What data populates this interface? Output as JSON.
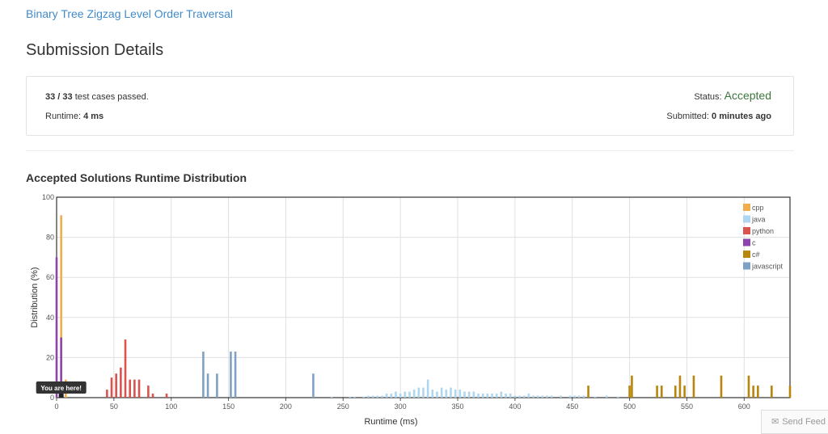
{
  "problem": {
    "title": "Binary Tree Zigzag Level Order Traversal"
  },
  "page": {
    "title": "Submission Details"
  },
  "submission": {
    "passed": "33 / 33",
    "passed_suffix": " test cases passed.",
    "runtime_label": "Runtime: ",
    "runtime_value": "4 ms",
    "status_label": "Status: ",
    "status_value": "Accepted",
    "submitted_label": "Submitted: ",
    "submitted_value": "0 minutes ago"
  },
  "distribution": {
    "title": "Accepted Solutions Runtime Distribution"
  },
  "marker": {
    "text": "You are here!"
  },
  "feedback": {
    "label": "Send Feed",
    "icon": "envelope-icon"
  },
  "chart_data": {
    "type": "bar",
    "xlabel": "Runtime (ms)",
    "ylabel": "Distribution (%)",
    "xlim": [
      0,
      640
    ],
    "ylim": [
      0,
      100
    ],
    "xticks": [
      0,
      50,
      100,
      150,
      200,
      250,
      300,
      350,
      400,
      450,
      500,
      550,
      600
    ],
    "yticks": [
      0,
      20,
      40,
      60,
      80,
      100
    ],
    "grid": true,
    "legend": "top-right",
    "marker_x": 4,
    "series": [
      {
        "name": "cpp",
        "color": "#f0ad4e",
        "points": [
          [
            4,
            91
          ],
          [
            8,
            9
          ]
        ]
      },
      {
        "name": "java",
        "color": "#aed6f1",
        "points": [
          [
            240,
            0.5
          ],
          [
            256,
            0.5
          ],
          [
            260,
            0.5
          ],
          [
            268,
            0.5
          ],
          [
            272,
            1
          ],
          [
            276,
            1
          ],
          [
            280,
            1
          ],
          [
            284,
            1
          ],
          [
            288,
            2
          ],
          [
            292,
            2
          ],
          [
            296,
            3
          ],
          [
            300,
            2
          ],
          [
            304,
            3
          ],
          [
            308,
            3
          ],
          [
            312,
            4
          ],
          [
            316,
            5
          ],
          [
            320,
            5
          ],
          [
            324,
            9
          ],
          [
            328,
            4
          ],
          [
            332,
            3
          ],
          [
            336,
            5
          ],
          [
            340,
            4
          ],
          [
            344,
            5
          ],
          [
            348,
            4
          ],
          [
            352,
            4
          ],
          [
            356,
            3
          ],
          [
            360,
            3
          ],
          [
            364,
            3
          ],
          [
            368,
            2
          ],
          [
            372,
            2
          ],
          [
            376,
            2
          ],
          [
            380,
            2
          ],
          [
            384,
            2
          ],
          [
            388,
            3
          ],
          [
            392,
            2
          ],
          [
            396,
            2
          ],
          [
            400,
            1
          ],
          [
            404,
            1
          ],
          [
            408,
            1
          ],
          [
            412,
            2
          ],
          [
            416,
            1
          ],
          [
            420,
            1
          ],
          [
            424,
            1
          ],
          [
            428,
            1
          ],
          [
            432,
            1
          ],
          [
            440,
            1
          ],
          [
            448,
            1
          ],
          [
            452,
            1
          ],
          [
            456,
            1
          ],
          [
            460,
            1
          ],
          [
            470,
            0.5
          ],
          [
            480,
            1
          ],
          [
            490,
            0.5
          ]
        ]
      },
      {
        "name": "python",
        "color": "#d9534f",
        "points": [
          [
            44,
            4
          ],
          [
            48,
            10
          ],
          [
            52,
            12
          ],
          [
            56,
            15
          ],
          [
            60,
            29
          ],
          [
            64,
            9
          ],
          [
            68,
            9
          ],
          [
            72,
            9
          ],
          [
            80,
            6
          ],
          [
            84,
            2
          ],
          [
            96,
            2
          ]
        ]
      },
      {
        "name": "c",
        "color": "#8e44ad",
        "points": [
          [
            0,
            70
          ],
          [
            4,
            30
          ]
        ]
      },
      {
        "name": "c#",
        "color": "#b8860b",
        "points": [
          [
            464,
            6
          ],
          [
            500,
            6
          ],
          [
            502,
            11
          ],
          [
            524,
            6
          ],
          [
            528,
            6
          ],
          [
            540,
            6
          ],
          [
            544,
            11
          ],
          [
            548,
            6
          ],
          [
            556,
            11
          ],
          [
            580,
            11
          ],
          [
            604,
            11
          ],
          [
            608,
            6
          ],
          [
            612,
            6
          ],
          [
            624,
            6
          ],
          [
            640,
            6
          ]
        ]
      },
      {
        "name": "javascript",
        "color": "#7ea1c4",
        "points": [
          [
            128,
            23
          ],
          [
            132,
            12
          ],
          [
            140,
            12
          ],
          [
            152,
            23
          ],
          [
            156,
            23
          ],
          [
            224,
            12
          ]
        ]
      }
    ]
  }
}
